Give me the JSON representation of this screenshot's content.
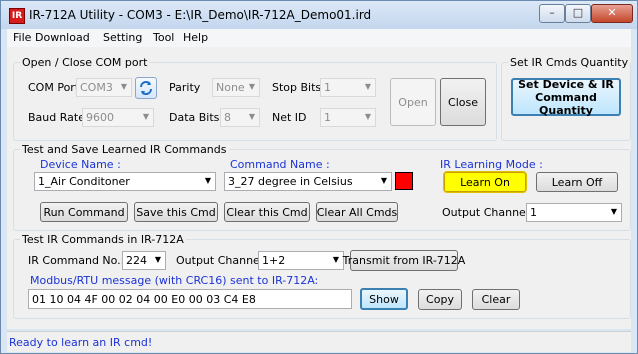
{
  "window": {
    "title": "IR-712A Utility - COM3 - E:\\IR_Demo\\IR-712A_Demo01.ird",
    "app_icon": "IR",
    "controls": {
      "minimize": "–",
      "maximize": "□",
      "close": "✕"
    }
  },
  "menu": [
    "File",
    "Download",
    "Setting",
    "Tool",
    "Help"
  ],
  "com_group": {
    "title": "Open / Close COM port",
    "com_port_label": "COM Port",
    "com_port_value": "COM3",
    "parity_label": "Parity",
    "parity_value": "None",
    "stop_bits_label": "Stop Bits",
    "stop_bits_value": "1",
    "baud_rate_label": "Baud Rate",
    "baud_rate_value": "9600",
    "data_bits_label": "Data Bits",
    "data_bits_value": "8",
    "net_id_label": "Net ID",
    "net_id_value": "1",
    "open_label": "Open",
    "close_label": "Close",
    "refresh_icon": "refresh-icon"
  },
  "quantity_group": {
    "title": "Set IR Cmds Quantity",
    "button_label": "Set Device & IR Command Quantity"
  },
  "learn_group": {
    "title": "Test and Save Learned IR Commands",
    "device_name_label": "Device Name :",
    "device_name_value": "1_Air Conditoner",
    "command_name_label": "Command Name :",
    "command_name_value": "3_27 degree in Celsius",
    "command_color": "#ff0000",
    "learning_mode_label": "IR Learning Mode :",
    "learn_on_label": "Learn On",
    "learn_off_label": "Learn Off",
    "run_command_label": "Run Command",
    "save_cmd_label": "Save this Cmd",
    "clear_cmd_label": "Clear this Cmd",
    "clear_all_label": "Clear All Cmds",
    "output_channel_label": "Output Channel :",
    "output_channel_value": "1"
  },
  "test_group": {
    "title": "Test IR Commands in IR-712A",
    "ir_command_no_label": "IR Command No.:",
    "ir_command_no_value": "224",
    "output_channel_label": "Output Channel:",
    "output_channel_value": "1+2",
    "transmit_label": "Transmit from IR-712A",
    "modbus_label": "Modbus/RTU message (with CRC16) sent to IR-712A:",
    "modbus_value": "01 10 04 4F 00 02 04 00 E0 00 03 C4 E8",
    "show_label": "Show",
    "copy_label": "Copy",
    "clear_label": "Clear"
  },
  "status": "Ready to learn an IR cmd!",
  "arrow": "▼"
}
